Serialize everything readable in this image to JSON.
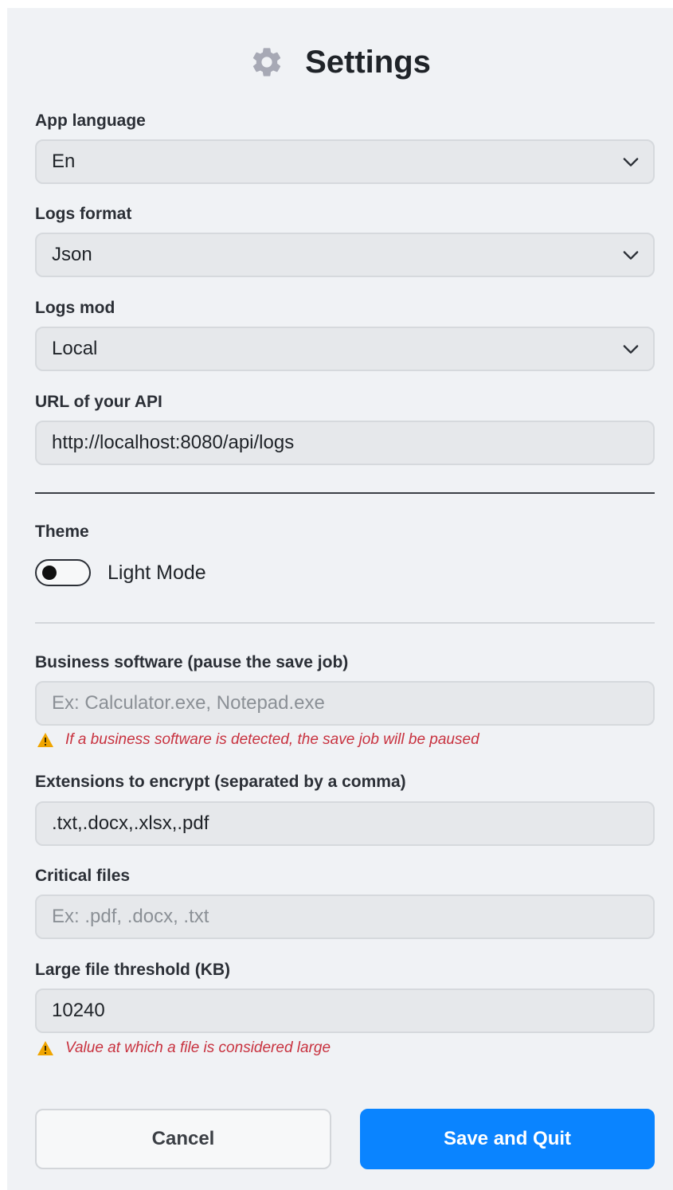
{
  "header": {
    "title": "Settings",
    "icon": "gear-icon"
  },
  "app_language": {
    "label": "App language",
    "value": "En"
  },
  "logs_format": {
    "label": "Logs format",
    "value": "Json"
  },
  "logs_mod": {
    "label": "Logs mod",
    "value": "Local"
  },
  "api_url": {
    "label": "URL of your API",
    "value": "http://localhost:8080/api/logs"
  },
  "theme": {
    "label": "Theme",
    "toggle_label": "Light Mode",
    "enabled": false
  },
  "business_software": {
    "label": "Business software (pause the save job)",
    "value": "",
    "placeholder": "Ex: Calculator.exe, Notepad.exe",
    "warning": "If a business software is detected, the save job will be paused"
  },
  "extensions": {
    "label": "Extensions to encrypt (separated by a comma)",
    "value": ".txt,.docx,.xlsx,.pdf"
  },
  "critical_files": {
    "label": "Critical files",
    "value": "",
    "placeholder": "Ex: .pdf, .docx, .txt"
  },
  "large_file": {
    "label": "Large file threshold (KB)",
    "value": "10240",
    "warning": "Value at which a file is considered large"
  },
  "buttons": {
    "cancel": "Cancel",
    "save": "Save and Quit"
  },
  "colors": {
    "accent": "#0a84ff",
    "warning": "#c8323f",
    "warning_icon": "#f0a500"
  }
}
